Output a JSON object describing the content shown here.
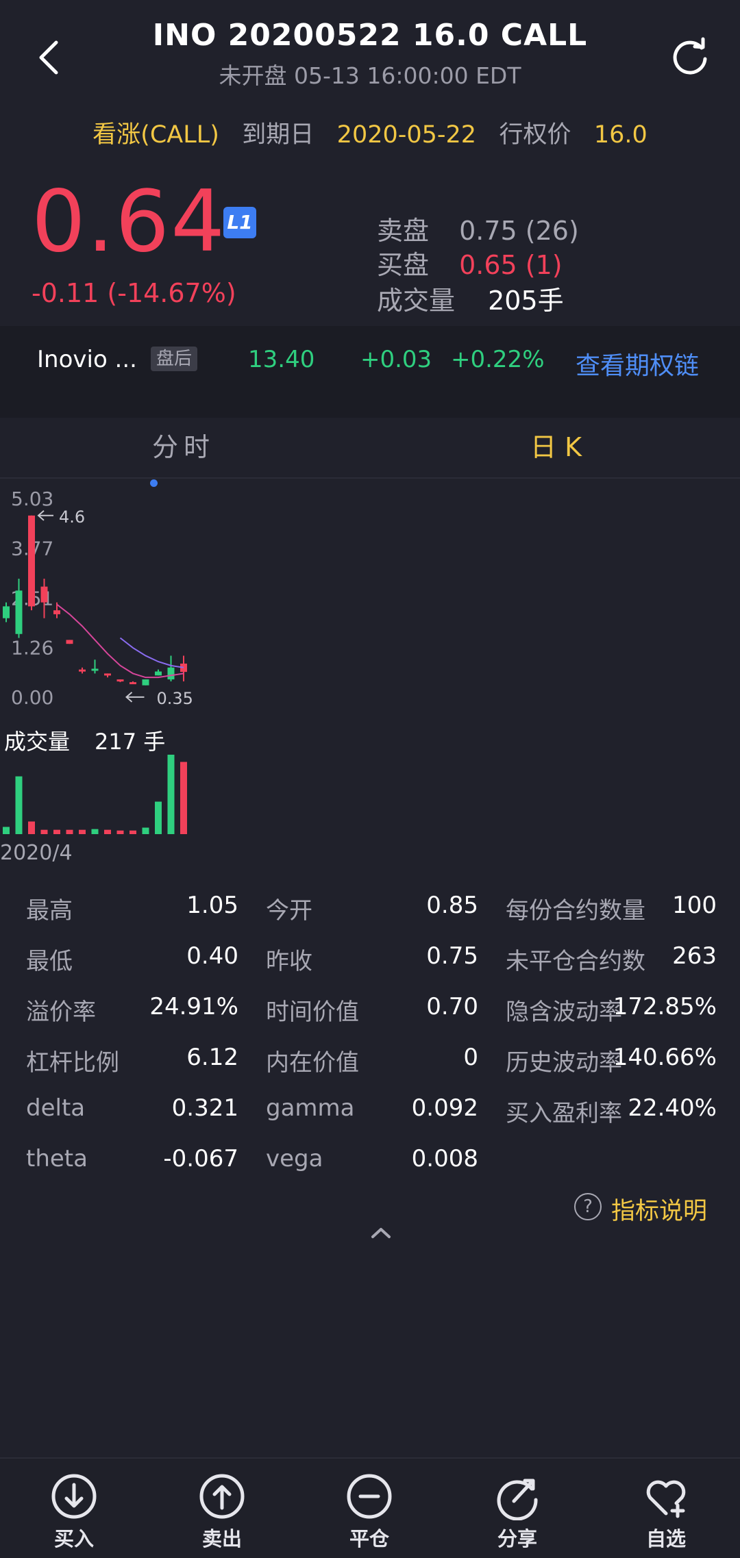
{
  "header": {
    "title": "INO 20200522 16.0 CALL",
    "subtitle": "未开盘 05-13 16:00:00 EDT"
  },
  "contract": {
    "direction": "看涨(CALL)",
    "expiry_label": "到期日",
    "expiry": "2020-05-22",
    "strike_label": "行权价",
    "strike": "16.0"
  },
  "quote": {
    "price": "0.64",
    "level_badge": "L1",
    "change": "-0.11 (-14.67%)",
    "ask_label": "卖盘",
    "ask": "0.75 (26)",
    "bid_label": "买盘",
    "bid": "0.65 (1)",
    "volume_label": "成交量",
    "volume": "205手"
  },
  "underlying": {
    "name": "Inovio ...",
    "session_badge": "盘后",
    "price": "13.40",
    "change": "+0.03",
    "change_pct": "+0.22%",
    "option_chain_link": "查看期权链"
  },
  "tabs": {
    "intraday": "分时",
    "daily_k": "日 K",
    "active": "daily_k"
  },
  "chart_data": {
    "type": "candlestick",
    "y_ticks": [
      "5.03",
      "3.77",
      "2.51",
      "1.26",
      "0.00"
    ],
    "ylim": [
      0,
      5.03
    ],
    "max_marker": "4.6",
    "min_marker": "0.35",
    "x_label": "2020/4",
    "volume_label": "成交量",
    "volume_value": "217 手",
    "candles": [
      {
        "o": 2.0,
        "c": 2.3,
        "h": 2.4,
        "l": 1.9,
        "dir": "up"
      },
      {
        "o": 1.6,
        "c": 2.7,
        "h": 3.0,
        "l": 1.5,
        "dir": "up"
      },
      {
        "o": 4.6,
        "c": 2.3,
        "h": 4.6,
        "l": 2.2,
        "dir": "down"
      },
      {
        "o": 2.8,
        "c": 2.4,
        "h": 3.0,
        "l": 2.0,
        "dir": "down"
      },
      {
        "o": 2.2,
        "c": 2.1,
        "h": 2.4,
        "l": 2.0,
        "dir": "down"
      },
      {
        "o": 1.45,
        "c": 1.35,
        "h": 1.45,
        "l": 1.35,
        "dir": "down"
      },
      {
        "o": 0.7,
        "c": 0.65,
        "h": 0.75,
        "l": 0.6,
        "dir": "down"
      },
      {
        "o": 0.7,
        "c": 0.72,
        "h": 0.95,
        "l": 0.6,
        "dir": "up"
      },
      {
        "o": 0.6,
        "c": 0.55,
        "h": 0.6,
        "l": 0.5,
        "dir": "down"
      },
      {
        "o": 0.45,
        "c": 0.4,
        "h": 0.45,
        "l": 0.38,
        "dir": "down"
      },
      {
        "o": 0.38,
        "c": 0.35,
        "h": 0.4,
        "l": 0.35,
        "dir": "down"
      },
      {
        "o": 0.3,
        "c": 0.45,
        "h": 0.45,
        "l": 0.3,
        "dir": "up"
      },
      {
        "o": 0.55,
        "c": 0.65,
        "h": 0.7,
        "l": 0.55,
        "dir": "up"
      },
      {
        "o": 0.45,
        "c": 0.75,
        "h": 1.05,
        "l": 0.4,
        "dir": "up"
      },
      {
        "o": 0.85,
        "c": 0.64,
        "h": 1.05,
        "l": 0.4,
        "dir": "down"
      }
    ],
    "ma_short": [
      null,
      null,
      null,
      null,
      2.35,
      2.1,
      1.8,
      1.45,
      1.1,
      0.8,
      0.6,
      0.5,
      0.5,
      0.55,
      0.6
    ],
    "ma_long": [
      null,
      null,
      null,
      null,
      null,
      null,
      null,
      null,
      null,
      1.5,
      1.25,
      1.05,
      0.9,
      0.8,
      0.75
    ],
    "volumes": [
      20,
      160,
      35,
      12,
      12,
      12,
      12,
      14,
      12,
      10,
      10,
      18,
      90,
      220,
      200
    ],
    "volume_dirs": [
      "up",
      "up",
      "down",
      "down",
      "down",
      "down",
      "down",
      "up",
      "down",
      "down",
      "down",
      "up",
      "up",
      "up",
      "down"
    ]
  },
  "stats": [
    [
      {
        "label": "最高",
        "value": "1.05"
      },
      {
        "label": "今开",
        "value": "0.85"
      },
      {
        "label": "每份合约数量",
        "value": "100"
      }
    ],
    [
      {
        "label": "最低",
        "value": "0.40"
      },
      {
        "label": "昨收",
        "value": "0.75"
      },
      {
        "label": "未平仓合约数",
        "value": "263"
      }
    ],
    [
      {
        "label": "溢价率",
        "value": "24.91%"
      },
      {
        "label": "时间价值",
        "value": "0.70"
      },
      {
        "label": "隐含波动率",
        "value": "172.85%"
      }
    ],
    [
      {
        "label": "杠杆比例",
        "value": "6.12"
      },
      {
        "label": "内在价值",
        "value": "0"
      },
      {
        "label": "历史波动率",
        "value": "140.66%"
      }
    ],
    [
      {
        "label": "delta",
        "value": "0.321"
      },
      {
        "label": "gamma",
        "value": "0.092"
      },
      {
        "label": "买入盈利率",
        "value": "22.40%"
      }
    ],
    [
      {
        "label": "theta",
        "value": "-0.067"
      },
      {
        "label": "vega",
        "value": "0.008"
      }
    ]
  ],
  "help": {
    "icon_glyph": "?",
    "label": "指标说明"
  },
  "bottom_nav": [
    {
      "label": "买入",
      "icon": "buy-icon"
    },
    {
      "label": "卖出",
      "icon": "sell-icon"
    },
    {
      "label": "平仓",
      "icon": "close-position-icon"
    },
    {
      "label": "分享",
      "icon": "share-icon"
    },
    {
      "label": "自选",
      "icon": "watchlist-icon"
    }
  ],
  "colors": {
    "background": "#20212b",
    "up": "#2fcf7f",
    "down": "#f2415a",
    "accent_yellow": "#f2c744",
    "link_blue": "#4f8ef7",
    "ma_short": "#d6469a",
    "ma_long": "#8a6cf0"
  }
}
